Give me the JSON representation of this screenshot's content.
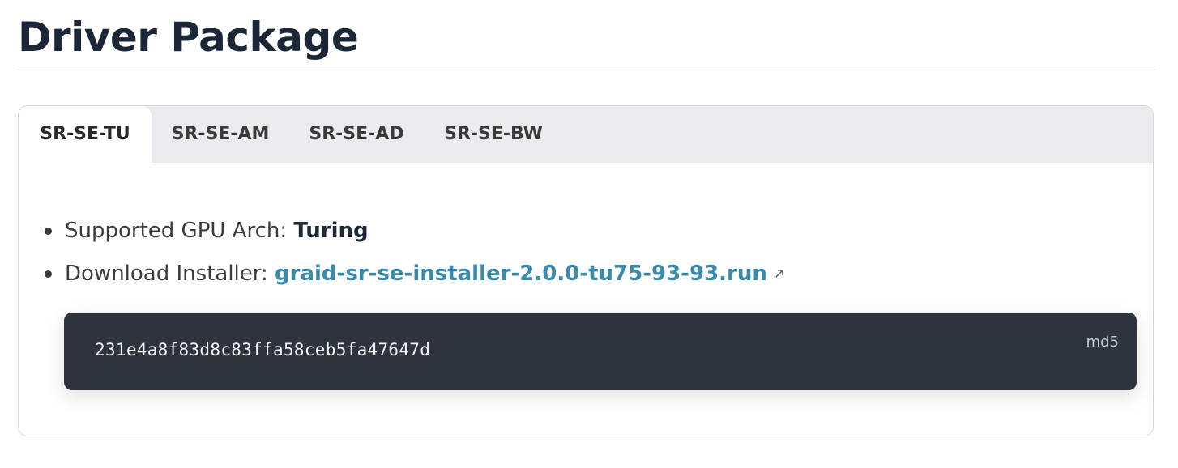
{
  "page": {
    "title": "Driver Package"
  },
  "tabs": [
    {
      "label": "SR-SE-TU",
      "active": true
    },
    {
      "label": "SR-SE-AM",
      "active": false
    },
    {
      "label": "SR-SE-AD",
      "active": false
    },
    {
      "label": "SR-SE-BW",
      "active": false
    }
  ],
  "panel": {
    "gpu_arch_label": "Supported GPU Arch: ",
    "gpu_arch_value": "Turing",
    "download_label": "Download Installer: ",
    "download_link_text": "graid-sr-se-installer-2.0.0-tu75-93-93.run",
    "external_icon": "external-link-icon"
  },
  "code_block": {
    "content": "231e4a8f83d8c83ffa58ceb5fa47647d",
    "language": "md5"
  },
  "colors": {
    "title": "#1b2637",
    "link": "#3a8bab",
    "tab_bar_bg": "#ebebef",
    "code_bg": "#2f333e"
  }
}
